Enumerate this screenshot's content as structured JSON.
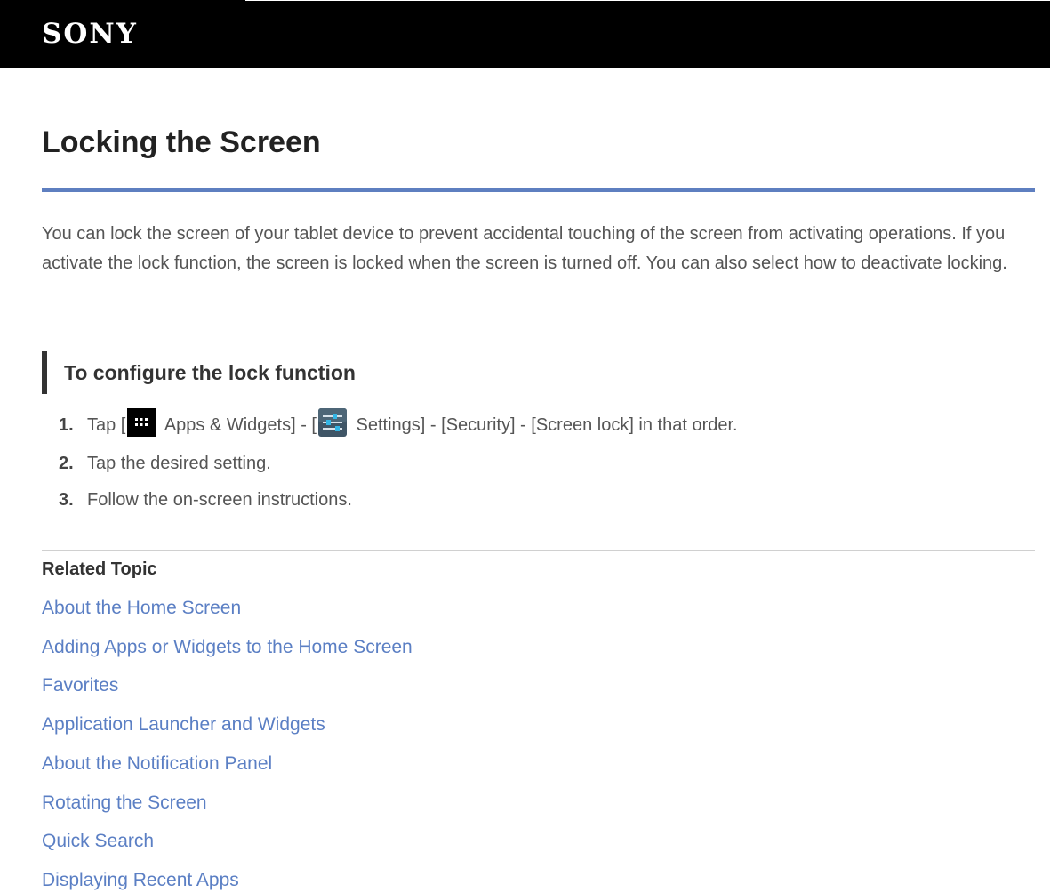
{
  "header": {
    "logo": "SONY",
    "colors": {
      "background": "#000000",
      "logo": "#ffffff"
    }
  },
  "page": {
    "title": "Locking the Screen",
    "intro": "You can lock the screen of your tablet device to prevent accidental touching of the screen from activating operations. If you activate the lock function, the screen is locked when the screen is turned off. You can also select how to deactivate locking.",
    "accent_color": "#5e7fc0"
  },
  "section": {
    "heading": "To configure the lock function",
    "steps": [
      {
        "num": "1.",
        "parts": {
          "a": "Tap [",
          "apps_icon": "apps-grid-icon",
          "b": " Apps & Widgets] - [",
          "settings_icon": "settings-sliders-icon",
          "c": " Settings] - [Security] - [Screen lock] in that order."
        }
      },
      {
        "num": "2.",
        "text": "Tap the desired setting."
      },
      {
        "num": "3.",
        "text": "Follow the on-screen instructions."
      }
    ]
  },
  "related": {
    "heading": "Related Topic",
    "link_color": "#5b7fc4",
    "links": [
      "About the Home Screen",
      "Adding Apps or Widgets to the Home Screen",
      "Favorites",
      "Application Launcher and Widgets",
      "About the Notification Panel",
      "Rotating the Screen",
      "Quick Search",
      "Displaying Recent Apps"
    ]
  }
}
